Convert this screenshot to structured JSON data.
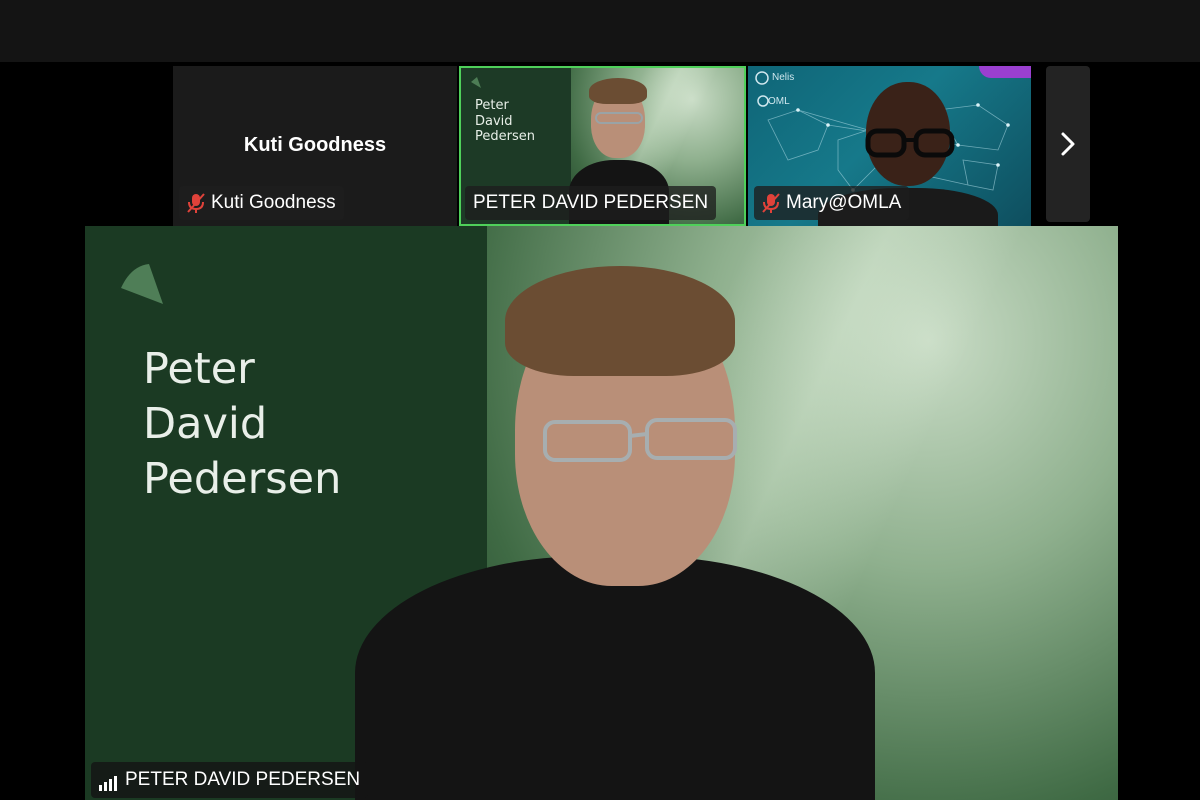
{
  "gallery": {
    "tiles": [
      {
        "center_name": "Kuti Goodness",
        "tag": "Kuti Goodness",
        "muted": true
      },
      {
        "slide_name_lines": [
          "Peter",
          "David",
          "Pedersen"
        ],
        "tag": "PETER DAVID PEDERSEN",
        "muted": false,
        "active": true
      },
      {
        "logo_text": "Nelis",
        "sub_logo": "OML",
        "tag": "Mary@OMLA",
        "muted": true
      }
    ],
    "next_icon": "chevron-right-icon"
  },
  "main": {
    "slide_name_lines": [
      "Peter",
      "David",
      "Pedersen"
    ],
    "tag": "PETER DAVID PEDERSEN",
    "signal_icon": "signal-bars-icon"
  },
  "colors": {
    "active_border": "#4fd05a",
    "slide_green": "#1b3a23",
    "muted_red": "#e0423a"
  }
}
